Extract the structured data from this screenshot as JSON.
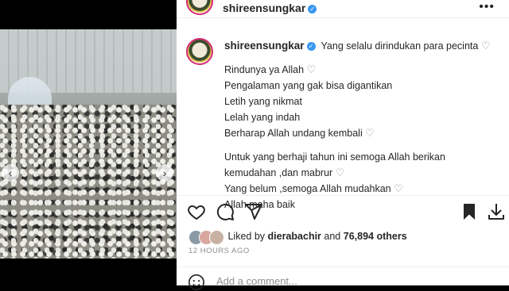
{
  "post": {
    "username": "shireensungkar",
    "caption_lines": [
      "Yang selalu dirindukan para pecinta",
      "Rindunya ya Allah",
      "Pengalaman yang gak bisa digantikan",
      "Letih yang nikmat",
      "Lelah yang indah",
      "Berharap Allah undang kembali",
      "Untuk yang berhaji tahun ini semoga Allah berikan",
      "kemudahan ,dan mabrur",
      "Yang belum ,semoga Allah mudahkan",
      "Allah maha baik"
    ],
    "liked_by_prefix": "Liked by",
    "liked_by_user": "dierabachir",
    "liked_by_and": "and",
    "others_count": "76,894 others",
    "timestamp": "12 HOURS AGO",
    "comment_placeholder": "Add a comment..."
  },
  "icons": [
    "heart-icon",
    "comment-icon",
    "share-icon",
    "bookmark-icon",
    "download-icon",
    "verified-icon",
    "more-icon",
    "emoji-icon"
  ],
  "colors": {
    "verified": "#3897f0",
    "ring": "#d62976",
    "muted": "#8e8e8e"
  }
}
